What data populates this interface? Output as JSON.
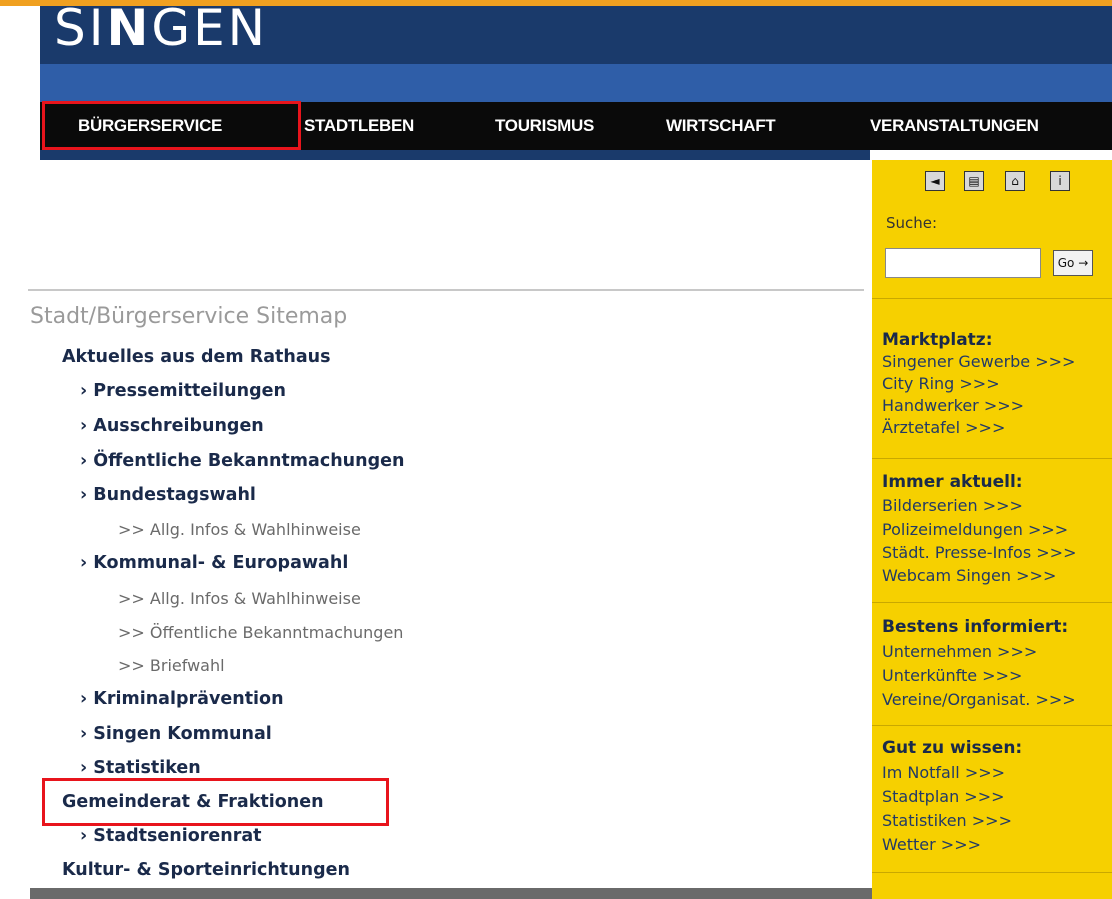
{
  "header": {
    "logo_part1": "SI",
    "logo_part2": "N",
    "logo_part3": "GEN"
  },
  "nav": [
    {
      "label": "BÜRGERSERVICE"
    },
    {
      "label": "STADTLEBEN"
    },
    {
      "label": "TOURISMUS"
    },
    {
      "label": "WIRTSCHAFT"
    },
    {
      "label": "VERANSTALTUNGEN"
    }
  ],
  "sidebar": {
    "icons": [
      "back-icon",
      "print-icon",
      "home-icon",
      "info-icon"
    ],
    "icon_glyphs": [
      "◄",
      "▤",
      "⌂",
      "i"
    ],
    "search_label": "Suche:",
    "search_value": "",
    "go_label": "Go →",
    "sections": [
      {
        "head": "Marktplatz:",
        "links": [
          "Singener Gewerbe >>>",
          "City Ring >>>",
          "Handwerker >>>",
          "Ärztetafel >>>"
        ]
      },
      {
        "head": "Immer aktuell:",
        "links": [
          "Bilderserien >>>",
          "Polizeimeldungen >>>",
          "Städt. Presse-Infos >>>",
          "Webcam Singen >>>"
        ]
      },
      {
        "head": "Bestens informiert:",
        "links": [
          "Unternehmen >>>",
          "Unterkünfte >>>",
          "Vereine/Organisat. >>>"
        ]
      },
      {
        "head": "Gut zu wissen:",
        "links": [
          "Im Notfall >>>",
          "Stadtplan >>>",
          "Statistiken >>>",
          "Wetter >>>"
        ]
      }
    ]
  },
  "sitemap": {
    "title": "Stadt/Bürgerservice Sitemap",
    "items": [
      {
        "level": 1,
        "label": "Aktuelles aus dem Rathaus"
      },
      {
        "level": 2,
        "label": "› Pressemitteilungen"
      },
      {
        "level": 2,
        "label": "› Ausschreibungen"
      },
      {
        "level": 2,
        "label": "› Öffentliche Bekanntmachungen"
      },
      {
        "level": 2,
        "label": "› Bundestagswahl"
      },
      {
        "level": 3,
        "label": ">> Allg. Infos & Wahlhinweise"
      },
      {
        "level": 2,
        "label": "› Kommunal- & Europawahl"
      },
      {
        "level": 3,
        "label": ">> Allg. Infos & Wahlhinweise"
      },
      {
        "level": 3,
        "label": ">> Öffentliche Bekanntmachungen"
      },
      {
        "level": 3,
        "label": ">> Briefwahl"
      },
      {
        "level": 2,
        "label": "› Kriminalprävention"
      },
      {
        "level": 2,
        "label": "› Singen Kommunal"
      },
      {
        "level": 2,
        "label": "› Statistiken"
      },
      {
        "level": 1,
        "label": "Gemeinderat & Fraktionen"
      },
      {
        "level": 2,
        "label": "› Stadtseniorenrat"
      },
      {
        "level": 1,
        "label": "Kultur- & Sporteinrichtungen"
      }
    ]
  },
  "colors": {
    "header": "#1a3a6b",
    "band": "#2f5ea8",
    "nav": "#0a0a0a",
    "sidebar": "#f6d000",
    "highlight": "#e8141c",
    "accent_line": "#f0a020"
  }
}
